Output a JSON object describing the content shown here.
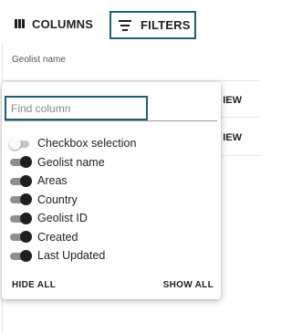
{
  "toolbar": {
    "columns_label": "COLUMNS",
    "filters_label": "FILTERS",
    "columns_icon": "view-column-icon",
    "filters_icon": "filter-list-icon"
  },
  "grid": {
    "header": "Geolist name",
    "row_actions": [
      "IEW",
      "IEW"
    ]
  },
  "column_panel": {
    "search_placeholder": "Find column",
    "options": [
      {
        "label": "Checkbox selection",
        "enabled": false
      },
      {
        "label": "Geolist name",
        "enabled": true
      },
      {
        "label": "Areas",
        "enabled": true
      },
      {
        "label": "Country",
        "enabled": true
      },
      {
        "label": "Geolist ID",
        "enabled": true
      },
      {
        "label": "Created",
        "enabled": true
      },
      {
        "label": "Last Updated",
        "enabled": true
      }
    ],
    "hide_all": "HIDE ALL",
    "show_all": "SHOW ALL"
  },
  "colors": {
    "focus_border": "#1f5f73",
    "switch_on_knob": "#1f1f1f",
    "switch_on_track": "#8e8e8e"
  }
}
